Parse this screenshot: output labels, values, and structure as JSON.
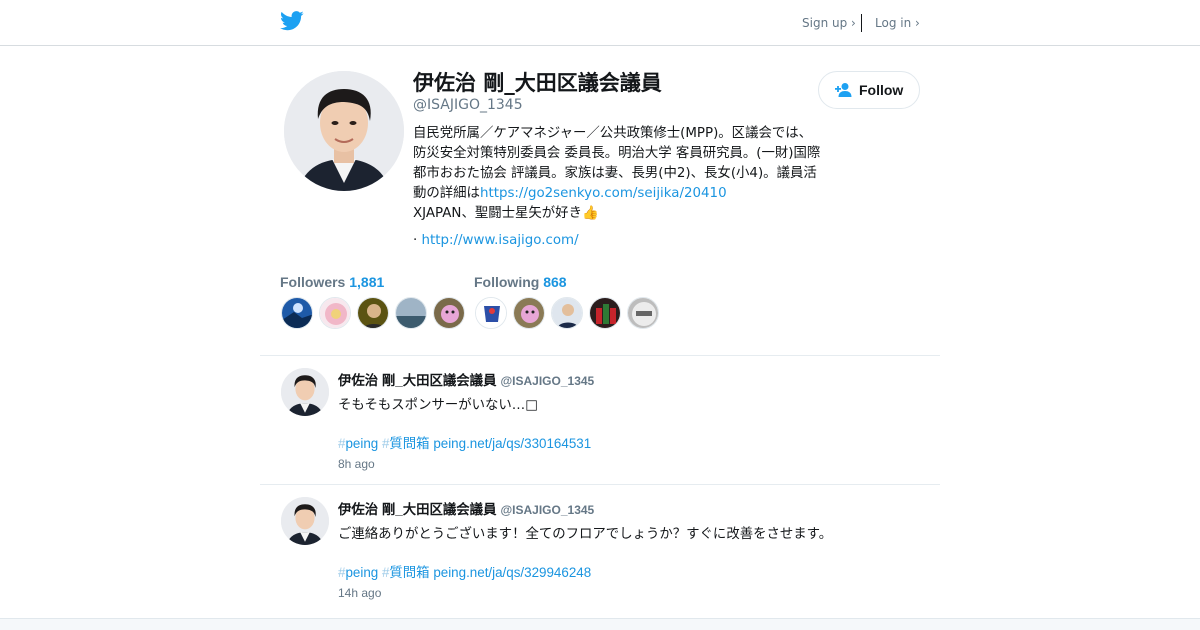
{
  "header": {
    "signup_label": "Sign up ›",
    "login_label": "Log in ›",
    "brand_color": "#1da1f2"
  },
  "profile": {
    "name": "伊佐治 剛_大田区議会議員",
    "handle": "@ISAJIGO_1345",
    "bio_text": "自民党所属／ケアマネジャー／公共政策修士(MPP)。区議会では、防災安全対策特別委員会 委員長。明治大学 客員研究員。(一財)国際都市おおた協会 評議員。家族は妻、長男(中2)、長女(小4)。議員活動の詳細は",
    "bio_link": "https://go2senkyo.com/seijika/20410",
    "bio_tail": "XJAPAN、聖闘士星矢が好き👍",
    "url_prefix": "·",
    "url": "http://www.isajigo.com/",
    "follow_label": "Follow"
  },
  "stats": {
    "followers_label": "Followers",
    "followers_count": "1,881",
    "following_label": "Following",
    "following_count": "868"
  },
  "tweets": [
    {
      "name": "伊佐治 剛_大田区議会議員",
      "handle": "@ISAJIGO_1345",
      "text": "そもそもスポンサーがいない…□",
      "hashtag1": "peing",
      "hashtag2": "質問箱",
      "link": "peing.net/ja/qs/330164531",
      "time": "8h ago"
    },
    {
      "name": "伊佐治 剛_大田区議会議員",
      "handle": "@ISAJIGO_1345",
      "text": "ご連絡ありがとうございます！全てのフロアでしょうか？すぐに改善をさせます。",
      "hashtag1": "peing",
      "hashtag2": "質問箱",
      "link": "peing.net/ja/qs/329946248",
      "time": "14h ago"
    }
  ]
}
